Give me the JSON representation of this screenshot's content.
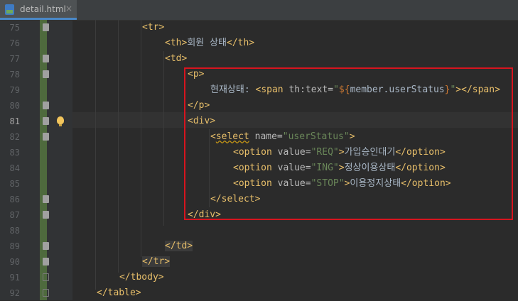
{
  "tab": {
    "label": "detail.html",
    "close": "×"
  },
  "lines": [
    {
      "n": "75",
      "parts": [
        [
          "tag",
          "<tr>"
        ]
      ]
    },
    {
      "n": "76",
      "parts": [
        [
          "tag",
          "<th>"
        ],
        [
          "txt",
          "회원 상태"
        ],
        [
          "tag",
          "</th>"
        ]
      ]
    },
    {
      "n": "77",
      "parts": [
        [
          "tag",
          "<td>"
        ]
      ]
    },
    {
      "n": "78",
      "parts": [
        [
          "tag",
          "<p>"
        ]
      ]
    },
    {
      "n": "79",
      "parts": [
        [
          "txt",
          "현재상태: "
        ],
        [
          "tag",
          "<span "
        ],
        [
          "attr",
          "th:text="
        ],
        [
          "str",
          "\""
        ],
        [
          "expr",
          "${"
        ],
        [
          "txt",
          "member.userStatus"
        ],
        [
          "expr",
          "}"
        ],
        [
          "str",
          "\""
        ],
        [
          "tag",
          "></span>"
        ]
      ]
    },
    {
      "n": "80",
      "parts": [
        [
          "tag",
          "</p>"
        ]
      ]
    },
    {
      "n": "81",
      "parts": [
        [
          "tag",
          "<div>"
        ]
      ]
    },
    {
      "n": "82",
      "parts": [
        [
          "tag",
          "<"
        ],
        [
          "tagwarn",
          "select"
        ],
        [
          "tag",
          " "
        ],
        [
          "attr",
          "name="
        ],
        [
          "str",
          "\"userStatus\""
        ],
        [
          "tag",
          ">"
        ]
      ]
    },
    {
      "n": "83",
      "parts": [
        [
          "tag",
          "<option "
        ],
        [
          "attr",
          "value="
        ],
        [
          "str",
          "\"REQ\""
        ],
        [
          "tag",
          ">"
        ],
        [
          "txt",
          "가입승인대기"
        ],
        [
          "tag",
          "</option>"
        ]
      ]
    },
    {
      "n": "84",
      "parts": [
        [
          "tag",
          "<option "
        ],
        [
          "attr",
          "value="
        ],
        [
          "str",
          "\"ING\""
        ],
        [
          "tag",
          ">"
        ],
        [
          "txt",
          "정상이용상태"
        ],
        [
          "tag",
          "</option>"
        ]
      ]
    },
    {
      "n": "85",
      "parts": [
        [
          "tag",
          "<option "
        ],
        [
          "attr",
          "value="
        ],
        [
          "str",
          "\"STOP\""
        ],
        [
          "tag",
          ">"
        ],
        [
          "txt",
          "이용정지상태"
        ],
        [
          "tag",
          "</option>"
        ]
      ]
    },
    {
      "n": "86",
      "parts": [
        [
          "tag",
          "</select>"
        ]
      ]
    },
    {
      "n": "87",
      "parts": [
        [
          "tag",
          "</div>"
        ]
      ]
    },
    {
      "n": "88",
      "parts": []
    },
    {
      "n": "89",
      "parts": [
        [
          "tag",
          "</td>"
        ]
      ]
    },
    {
      "n": "90",
      "parts": [
        [
          "tag",
          "</tr>"
        ]
      ]
    },
    {
      "n": "91",
      "parts": [
        [
          "tag",
          "</tbody>"
        ]
      ]
    },
    {
      "n": "92",
      "parts": [
        [
          "tag",
          "</table>"
        ]
      ]
    }
  ]
}
